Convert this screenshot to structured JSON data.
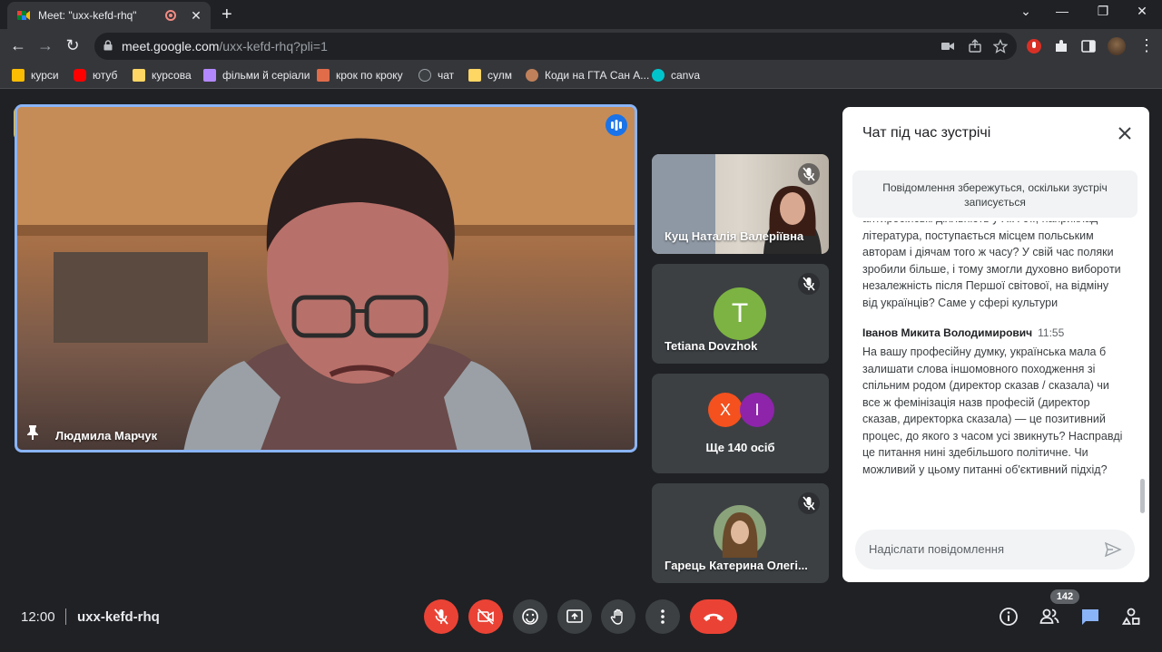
{
  "browser": {
    "tab_title": "Meet: \"uxx-kefd-rhq\"",
    "url_host": "meet.google.com",
    "url_path": "/uxx-kefd-rhq?pli=1"
  },
  "bookmarks": [
    {
      "label": "курси",
      "color": "#fbbc04"
    },
    {
      "label": "ютуб",
      "color": "#ff0000"
    },
    {
      "label": "курсова",
      "color": "#fdd663"
    },
    {
      "label": "фільми й серіали",
      "color": "#b388ff"
    },
    {
      "label": "крок по кроку",
      "color": "#e06c4a"
    },
    {
      "label": "чат",
      "color": "#9aa0a6"
    },
    {
      "label": "сулм",
      "color": "#fdd663"
    },
    {
      "label": "Коди на ГТА Сан А...",
      "color": "#c0805a"
    },
    {
      "label": "canva",
      "color": "#00c4cc"
    }
  ],
  "main_tile": {
    "name": "Людмила Марчук"
  },
  "side_tiles": [
    {
      "name": "Кущ Наталія Валеріївна"
    },
    {
      "name": "Tetiana Dovzhok",
      "letter": "T",
      "color": "#7cb342"
    },
    {
      "label": "Ще 140 осіб",
      "avatars": [
        {
          "letter": "Х",
          "color": "#f4511e"
        },
        {
          "letter": "І",
          "color": "#8e24aa"
        }
      ]
    },
    {
      "name": "Гарець Катерина Олегі..."
    }
  ],
  "chat": {
    "title": "Чат під час зустрічі",
    "notice": "Повідомлення збережуться, оскільки зустріч записується",
    "messages": [
      {
        "text": "антиросійські діяльність у ХІХ ст., наприклад література, поступається місцем польським авторам і діячам того ж часу? У свій час поляки зробили більше, і тому змогли духовно виборoти незалежність після Першої світової, на відміну від українців? Саме у сфері культури"
      },
      {
        "author": "Іванов Микита Володимирович",
        "time": "11:55",
        "text": "На вашу професійну думку, українська мала б залишати слова іншомовного походження зі спільним родом (директор сказав / сказала) чи все ж фемінізація назв професій (директор сказав, директорка сказала) — це позитивний процес, до якого з часом усі звикнуть? Насправді це питання нині здебільшого політичне. Чи можливий у цьому питанні об'єктивний підхід?"
      }
    ],
    "input_placeholder": "Надіслати повідомлення"
  },
  "bottom": {
    "time": "12:00",
    "meeting_code": "uxx-kefd-rhq",
    "participants_count": "142"
  }
}
